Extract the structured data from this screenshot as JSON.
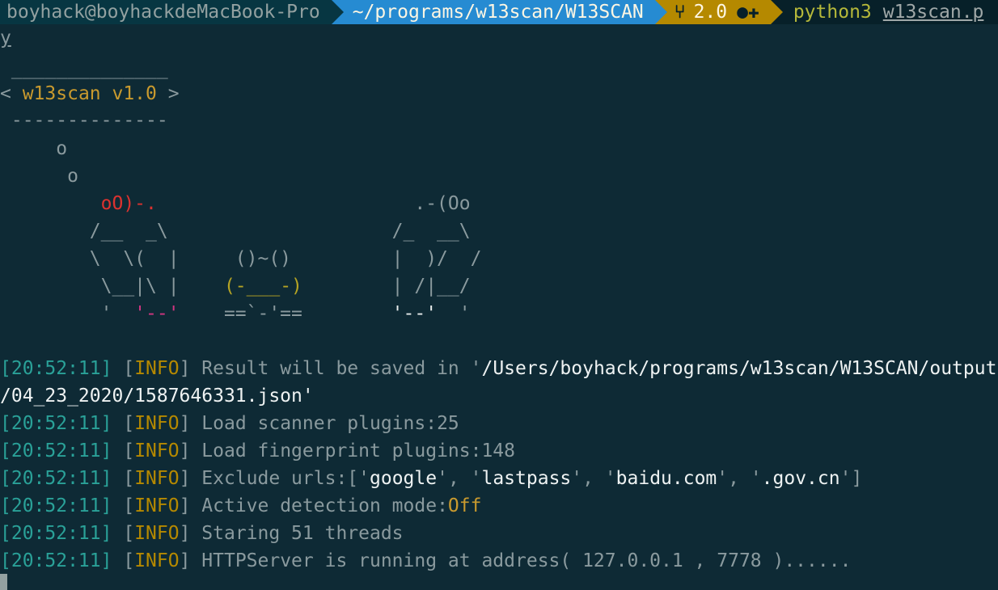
{
  "prompt": {
    "host": "boyhack@boyhackdeMacBook-Pro",
    "directory": "~/programs/w13scan/W13SCAN",
    "git_icon": "branch-icon",
    "branch": "2.0",
    "dirty": "●✚",
    "command": "python3",
    "file": "w13scan.p"
  },
  "input_echo": "y",
  "banner": {
    "top_border": " ______________",
    "title_left": "< ",
    "title": "w13scan v1.0",
    "title_right": " >",
    "bottom_border": " --------------",
    "bubble1": "     o",
    "bubble2": "      o",
    "row1_left": "         ",
    "row1_red": "oO)-.",
    "row1_right": "                       .-(Oo",
    "row2": "        /__  _\\                    /_  __\\",
    "row3": "        \\  \\(  |     ()~()         |  )/  /",
    "row4_a": "         \\__|\\ |    ",
    "row4_yellow": "(-___-)",
    "row4_b": "        | /|__/",
    "row5_a": "         '  ",
    "row5_magenta": "'--'",
    "row5_b": "    ==`-'==        ",
    "row5_white": "'--'",
    "row5_c": "  '"
  },
  "log": [
    {
      "ts": "[20:52:11]",
      "level": "INFO",
      "prefix": "Result will be saved in '",
      "value": "/Users/boyhack/programs/w13scan/W13SCAN/output",
      "suffix": ""
    },
    {
      "continuation": "/04_23_2020/1587646331.json'"
    },
    {
      "ts": "[20:52:11]",
      "level": "INFO",
      "prefix": "Load scanner plugins:25",
      "value": "",
      "suffix": ""
    },
    {
      "ts": "[20:52:11]",
      "level": "INFO",
      "prefix": "Load fingerprint plugins:148",
      "value": "",
      "suffix": ""
    },
    {
      "ts": "[20:52:11]",
      "level": "INFO",
      "prefix": "Exclude urls:['",
      "items": [
        "google",
        "lastpass",
        "baidu.com",
        ".gov.cn"
      ],
      "suffix": "']"
    },
    {
      "ts": "[20:52:11]",
      "level": "INFO",
      "prefix": "Active detection mode:",
      "value": "Off",
      "suffix": ""
    },
    {
      "ts": "[20:52:11]",
      "level": "INFO",
      "prefix": "Staring 51 threads",
      "value": "",
      "suffix": ""
    },
    {
      "ts": "[20:52:11]",
      "level": "INFO",
      "prefix": "HTTPServer is running at address( 127.0.0.1 , 7778 )......",
      "value": "",
      "suffix": ""
    }
  ],
  "colors": {
    "background": "#0e2a35",
    "timestamp": "#2aa198",
    "level": "#b58900",
    "directory_segment": "#268bd2",
    "git_segment": "#b58900"
  }
}
